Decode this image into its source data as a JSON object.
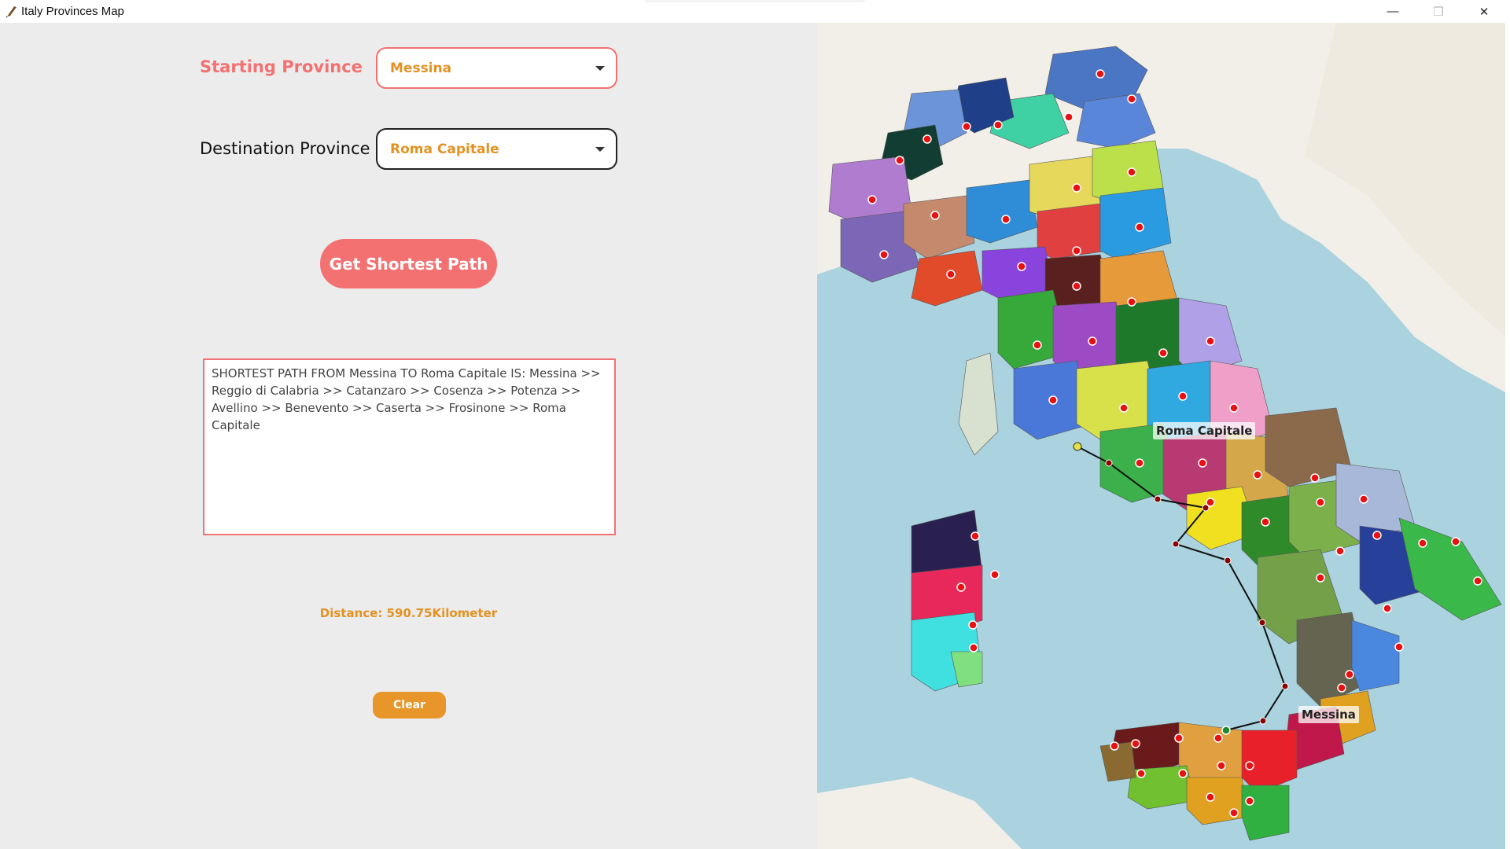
{
  "window": {
    "title": "Italy Provinces Map",
    "minimize_glyph": "—",
    "maximize_glyph": "❐",
    "close_glyph": "✕"
  },
  "form": {
    "start_label": "Starting Province",
    "start_value": "Messina",
    "dest_label": "Destination Province",
    "dest_value": "Roma Capitale",
    "path_button": "Get Shortest Path"
  },
  "result": {
    "text": "SHORTEST PATH FROM Messina TO Roma Capitale IS: Messina >> Reggio di Calabria >> Catanzaro >> Cosenza >> Potenza >> Avellino >> Benevento >> Caserta >> Frosinone >> Roma Capitale",
    "distance": "Distance: 590.75Kilometer"
  },
  "clear_button": "Clear",
  "map": {
    "start_marker_label": "Messina",
    "end_marker_label": "Roma Capitale",
    "route": [
      "Messina",
      "Reggio di Calabria",
      "Catanzaro",
      "Cosenza",
      "Potenza",
      "Avellino",
      "Benevento",
      "Caserta",
      "Frosinone",
      "Roma Capitale"
    ]
  },
  "colors": {
    "accent": "#f47172",
    "orange": "#e39223",
    "sea": "#aad3df",
    "land": "#f2efe9"
  }
}
